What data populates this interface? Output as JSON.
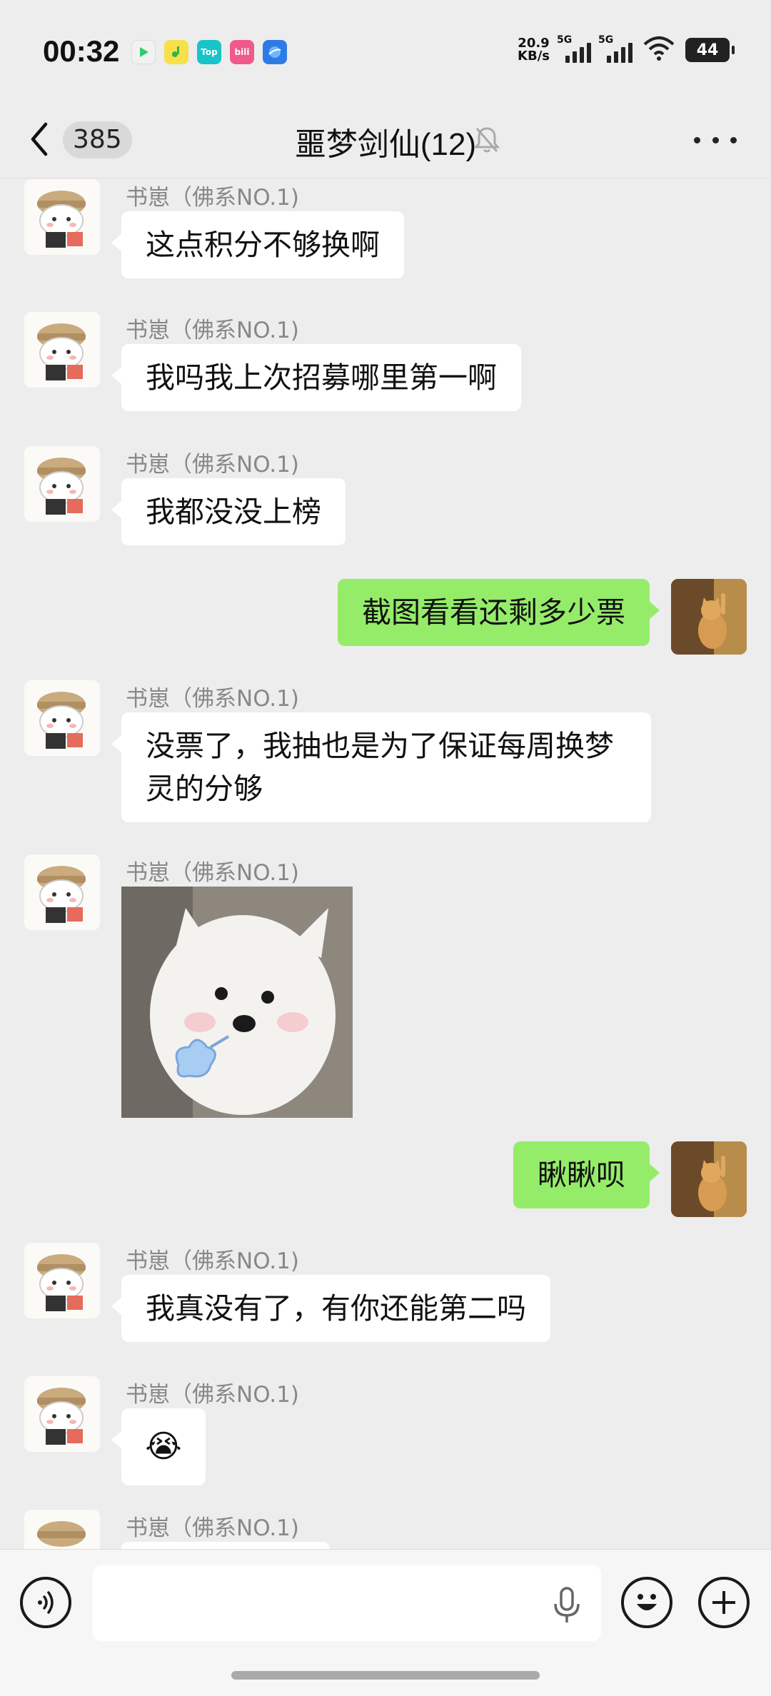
{
  "status_bar": {
    "time": "00:32",
    "net_speed_value": "20.9",
    "net_speed_unit": "KB/s",
    "signal1_label": "5G",
    "signal2_label": "5G",
    "battery": "44",
    "app_icons": [
      "video-icon",
      "qq-music-icon",
      "top-icon",
      "bilibili-icon",
      "browser-icon"
    ],
    "top_icon_text": "Top",
    "bili_icon_text": "bili"
  },
  "header": {
    "unread_count": "385",
    "title": "噩梦剑仙(12)"
  },
  "messages": [
    {
      "side": "in",
      "sender": "书崽（佛系NO.1)",
      "text": "这点积分不够换啊"
    },
    {
      "side": "in",
      "sender": "书崽（佛系NO.1)",
      "text": "我吗我上次招募哪里第一啊"
    },
    {
      "side": "in",
      "sender": "书崽（佛系NO.1)",
      "text": "我都没没上榜"
    },
    {
      "side": "out",
      "text": "截图看看还剩多少票"
    },
    {
      "side": "in",
      "sender": "书崽（佛系NO.1)",
      "text": "没票了，我抽也是为了保证每周换梦灵的分够"
    },
    {
      "side": "in",
      "sender": "书崽（佛系NO.1)",
      "type": "sticker"
    },
    {
      "side": "out",
      "text": "瞅瞅呗"
    },
    {
      "side": "in",
      "sender": "书崽（佛系NO.1)",
      "text": "我真没有了，有你还能第二吗"
    },
    {
      "side": "in",
      "sender": "书崽（佛系NO.1)",
      "text": "😭"
    },
    {
      "side": "in",
      "sender": "书崽（佛系NO.1)",
      "text": ""
    }
  ],
  "input": {
    "placeholder": ""
  },
  "colors": {
    "background": "#ededed",
    "outgoing_bubble": "#95ec69",
    "incoming_bubble": "#ffffff"
  }
}
